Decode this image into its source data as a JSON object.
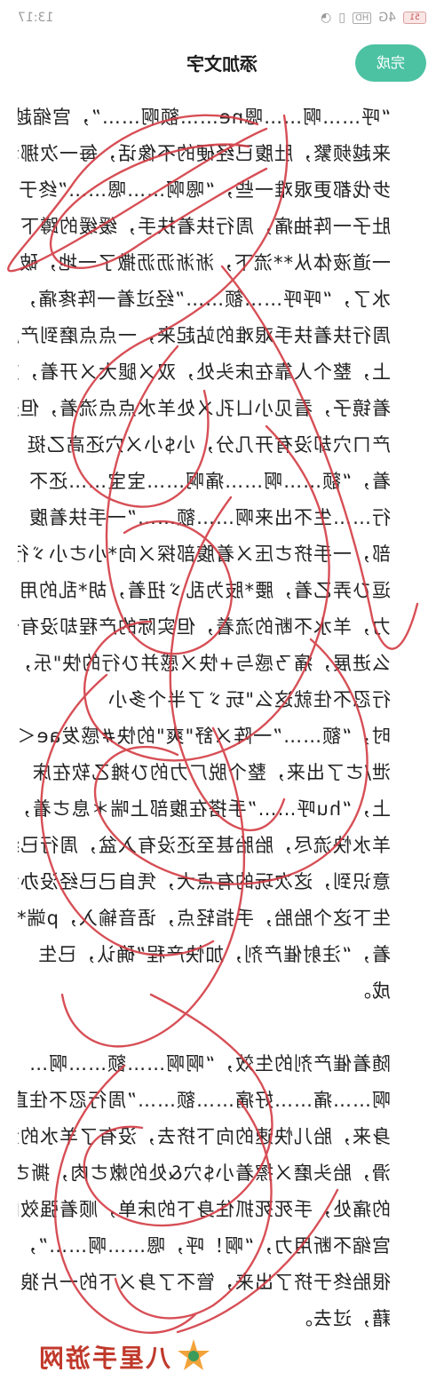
{
  "status_bar": {
    "time": "13:17",
    "signal": "4G",
    "hd": "HD",
    "battery": "51"
  },
  "header": {
    "title": "添加文字",
    "done_label": "完成"
  },
  "content": {
    "lines": [
      "“呼……啊……嗯ne……额啊……”，宫缩越",
      "来越频繁，肚腹已经硬的不像话，每一次挪动",
      "步伐都更艰难一些，“嗯啊……嗯……”终于",
      "肚子一阵抽痛，周行扶着扶手，缓缓的蹲下，",
      "一道液体从**流下，淅淅沥沥撒了一地，破",
      "水了，“呼呼……额……”经过着一阵疼痛，",
      "周行扶着扶手艰难的站起来，一点点磨到产床",
      "上，整个人靠在床头处，双ㄨ腿大ㄨ开着，对",
      "着镜子，看见小ㄩ孔ㄨ处羊水点点流着，但是",
      "产ㄇ穴却没有开几分，小$小ㄨ穴还高乙挺",
      "着，“额……啊……痛啊……宝宝……还不",
      "行……生不出来啊……额……”一手扶着腹",
      "部，一手挤ㄜ压ㄨ着腹部探ㄨ向*小ㄜ小ゞ行*",
      "逗ひ弄乙着，腰*肢为乱ゞ扭着，胡*乱的用",
      "力，羊水不断的流着，但实际的产程却没有什",
      "么进展，痛ㄋ感与+快ㄨ感并ひ行的快\"乐，让周",
      "行忍不住就这么\"玩ゞ了半个多小",
      "时，“额……”一阵ㄨ舒\"爽\"的快#感发ae＜",
      "泄/ㄜ了出来，整个脱ㄏ力的ひ摊乙软在床",
      "上，“hu呼……”手搭在腹部上喘＊息ㄜ着，",
      "羊水快流尽，胎胎甚至还没有入盆，周行已经",
      "意识到，这次玩的有点大，凭自己已经没办法",
      "生下这个胎胎，手指轻点，语音输入，p端*息",
      "着，“注射催产剂，加快产程”确认，已生",
      "成。",
      "",
      "随着催产剂的生效，“啊啊……额……啊…",
      "啊……痛……好痛……额……”周行忍不住直起",
      "身来，胎儿快速的向下挤去，没有了羊水的润",
      "滑，胎头磨ㄨ擦着小$穴&处的嫩ㄜ肉，撕ㄜ裂",
      "的痛处，手死死抓住身下的床单，顺着强效的",
      "宫缩不断用力，“啊！呼，嗯……啊……”，",
      "很胎终于挤了出来，管不了身ㄨ下的一片狼ゞ",
      "藉，过去。"
    ]
  },
  "scribble": {
    "color": "#d33c44"
  },
  "watermark": {
    "text": "八星手游网",
    "accent": "#c0392b"
  }
}
